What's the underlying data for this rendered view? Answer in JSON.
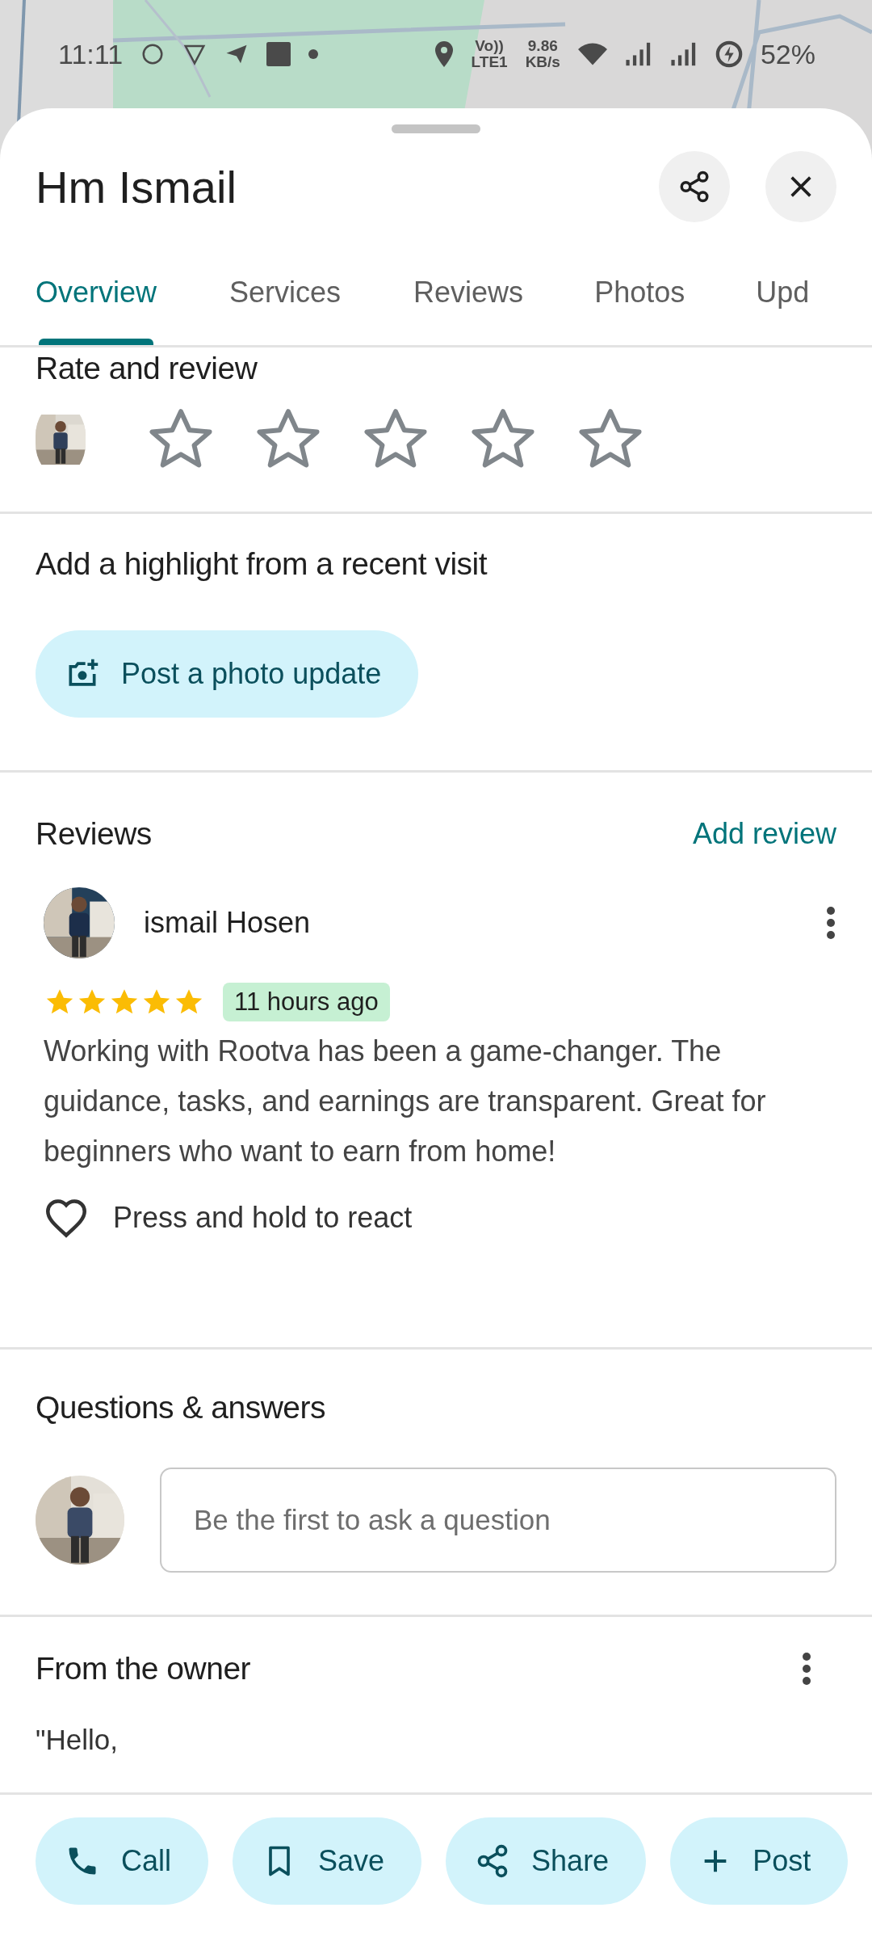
{
  "status_bar": {
    "time": "11:11",
    "network_labels": [
      "Vo))",
      "LTE1"
    ],
    "speed": [
      "9.86",
      "KB/s"
    ],
    "battery": "52%"
  },
  "sheet": {
    "title": "Hm Ismail"
  },
  "tabs": [
    {
      "label": "Overview",
      "selected": true
    },
    {
      "label": "Services",
      "selected": false
    },
    {
      "label": "Reviews",
      "selected": false
    },
    {
      "label": "Photos",
      "selected": false
    },
    {
      "label": "Upd",
      "selected": false
    }
  ],
  "rate": {
    "title": "Rate and review",
    "stars": 0
  },
  "highlight": {
    "title": "Add a highlight from a recent visit",
    "button": "Post a photo update"
  },
  "reviews": {
    "title": "Reviews",
    "action": "Add review",
    "items": [
      {
        "author": "ismail Hosen",
        "stars": 5,
        "time": "11 hours ago",
        "text": "Working with Rootva has been a game-changer. The guidance, tasks, and earnings are transparent. Great for beginners who want to earn from home!",
        "react": "Press and hold to react"
      }
    ]
  },
  "qa": {
    "title": "Questions & answers",
    "placeholder": "Be the first to ask a question"
  },
  "owner": {
    "title": "From the owner",
    "lines": [
      "\"Hello,"
    ]
  },
  "actions": [
    {
      "kind": "call",
      "label": "Call"
    },
    {
      "kind": "save",
      "label": "Save"
    },
    {
      "kind": "share",
      "label": "Share"
    },
    {
      "kind": "post",
      "label": "Post"
    }
  ]
}
